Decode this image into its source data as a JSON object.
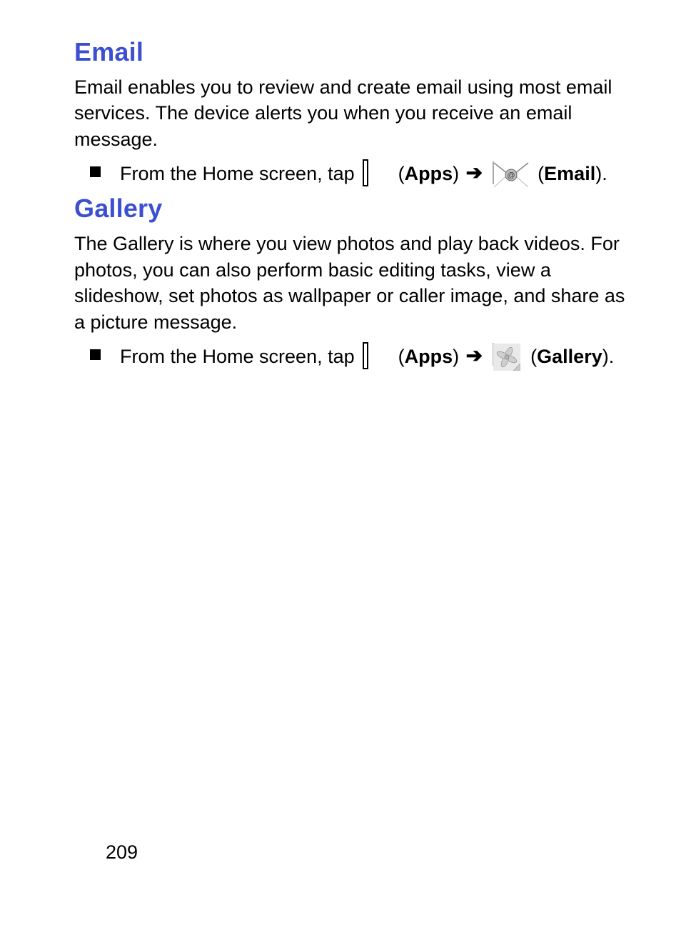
{
  "sections": {
    "email": {
      "heading": "Email",
      "paragraph": "Email enables you to review and create email using most email services. The device alerts you when you receive an email message.",
      "bullet": {
        "prefix": "From the Home screen, tap ",
        "apps_label": "Apps",
        "target_label": "Email"
      }
    },
    "gallery": {
      "heading": "Gallery",
      "paragraph": "The Gallery is where you view photos and play back videos. For photos, you can also perform basic editing tasks, view a slideshow, set photos as wallpaper or caller image, and share as a picture message.",
      "bullet": {
        "prefix": "From the Home screen, tap ",
        "apps_label": "Apps",
        "target_label": "Gallery"
      }
    }
  },
  "glyphs": {
    "arrow": "➔",
    "paren_open": "(",
    "paren_close": ") ",
    "paren_close_final": ")."
  },
  "page_number": "209"
}
